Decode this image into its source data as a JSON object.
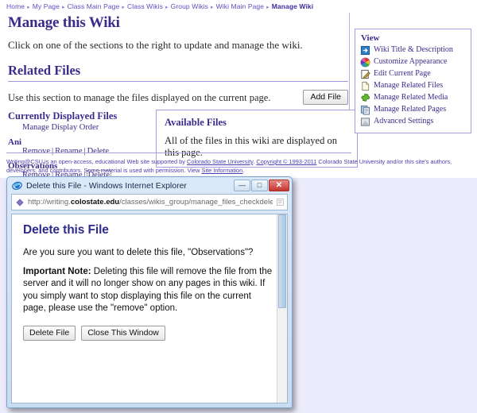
{
  "breadcrumb": {
    "items": [
      {
        "label": "Home",
        "current": false
      },
      {
        "label": "My Page",
        "current": false
      },
      {
        "label": "Class Main Page",
        "current": false
      },
      {
        "label": "Class Wikis",
        "current": false
      },
      {
        "label": "Group Wikis",
        "current": false
      },
      {
        "label": "Wiki Main Page",
        "current": false
      },
      {
        "label": "Manage Wiki",
        "current": true
      }
    ],
    "separator": "▸"
  },
  "page": {
    "title": "Manage this Wiki",
    "intro": "Click on one of the sections to the right to update and manage the wiki."
  },
  "related_files": {
    "heading": "Related Files",
    "description": "Use this section to manage the files displayed on the current page.",
    "add_file_label": "Add File",
    "currently_displayed_heading": "Currently Displayed Files",
    "manage_display_order_label": "Manage Display Order",
    "action_remove": "Remove",
    "action_rename": "Rename",
    "action_delete": "Delete",
    "separator": "|",
    "files": [
      {
        "name": "Ani",
        "focused_action": ""
      },
      {
        "name": "Observations",
        "focused_action": "Delete"
      }
    ]
  },
  "available_files": {
    "heading": "Available Files",
    "text": "All of the files in this wiki are displayed on this page."
  },
  "view_panel": {
    "title": "View",
    "items": [
      {
        "label": "Wiki Title & Description",
        "icon": "blue-arrow-page-icon"
      },
      {
        "label": "Customize Appearance",
        "icon": "color-wheel-icon"
      },
      {
        "label": "Edit Current Page",
        "icon": "pencil-page-icon"
      },
      {
        "label": "Manage Related Files",
        "icon": "document-icon"
      },
      {
        "label": "Manage Related Media",
        "icon": "green-puzzle-icon"
      },
      {
        "label": "Manage Related Pages",
        "icon": "stacked-pages-icon"
      },
      {
        "label": "Advanced Settings",
        "icon": "gray-square-icon"
      }
    ]
  },
  "footer": {
    "line1_a": "Writing@CSU is an open-access, educational Web site supported by ",
    "link_university": "Colorado State University",
    "line1_b": ". ",
    "link_copyright": "Copyright © 1993-2011",
    "line1_c": " Colorado State University and/or this site's authors,",
    "line2_a": "developers, and contributors. Some material is used with permission. View ",
    "link_site_info": "Site Information",
    "line2_b": "."
  },
  "ie_window": {
    "title": "Delete this File - Windows Internet Explorer",
    "logo_icon": "internet-explorer-icon",
    "address_icon": "globe-icon",
    "address_right_icon": "page-favicon-icon",
    "url_prefix": "http://writing.",
    "url_domain": "colostate.edu",
    "url_path": "/classes/wikis_group/manage_files_checkdelete.cfm?f",
    "minimize_glyph": "—",
    "maximize_glyph": "□",
    "close_glyph": "✕",
    "minimize_name": "minimize-button",
    "maximize_name": "maximize-button",
    "close_name": "close-button"
  },
  "dialog": {
    "title": "Delete this File",
    "question": "Are you sure you want to delete this file, \"Observations\"?",
    "note_label": "Important Note:",
    "note_text": " Deleting this file will remove the file from the server and it will no longer show on any pages in this wiki. If you simply want to stop displaying this file on the current page, please use the \"remove\" option.",
    "delete_button": "Delete File",
    "close_button": "Close This Window"
  },
  "colors": {
    "accent_purple": "#3b2b8c",
    "link_purple": "#5a4fc0",
    "page_background": "#ecebfb",
    "dialog_title": "#2d2b8e",
    "close_red": "#c2352e"
  }
}
